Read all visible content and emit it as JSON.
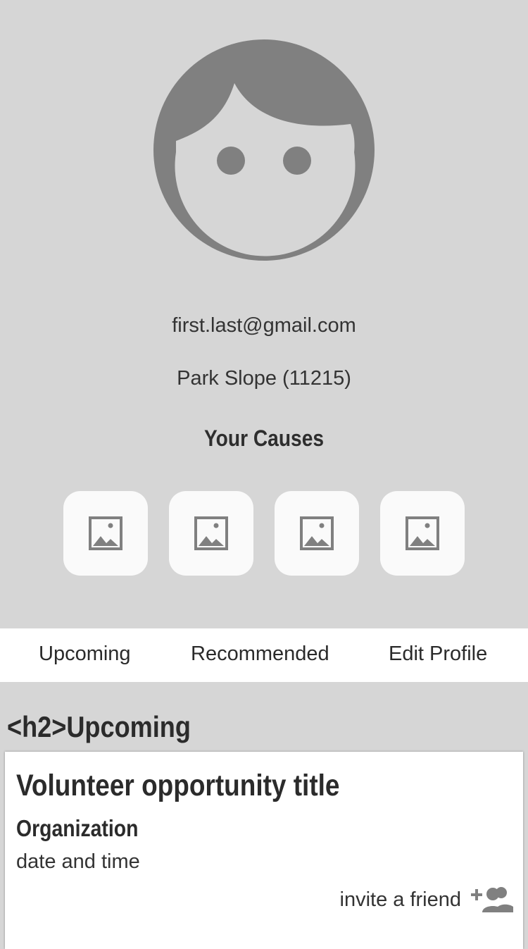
{
  "profile": {
    "avatar_icon": "face-icon",
    "email": "first.last@gmail.com",
    "location": "Park Slope (11215)",
    "causes_title": "Your Causes",
    "causes": [
      {
        "icon": "image-placeholder-icon"
      },
      {
        "icon": "image-placeholder-icon"
      },
      {
        "icon": "image-placeholder-icon"
      },
      {
        "icon": "image-placeholder-icon"
      }
    ]
  },
  "tabs": [
    {
      "label": "Upcoming"
    },
    {
      "label": "Recommended"
    },
    {
      "label": "Edit Profile"
    }
  ],
  "section": {
    "heading": "<h2>Upcoming"
  },
  "card": {
    "title": "Volunteer opportunity title",
    "organization": "Organization",
    "date": "date and time",
    "invite_label": "invite a friend",
    "invite_icon": "add-friend-icon"
  },
  "colors": {
    "background": "#d6d6d6",
    "icon_gray": "#808080",
    "surface": "#ffffff",
    "text": "#2a2a2a"
  }
}
